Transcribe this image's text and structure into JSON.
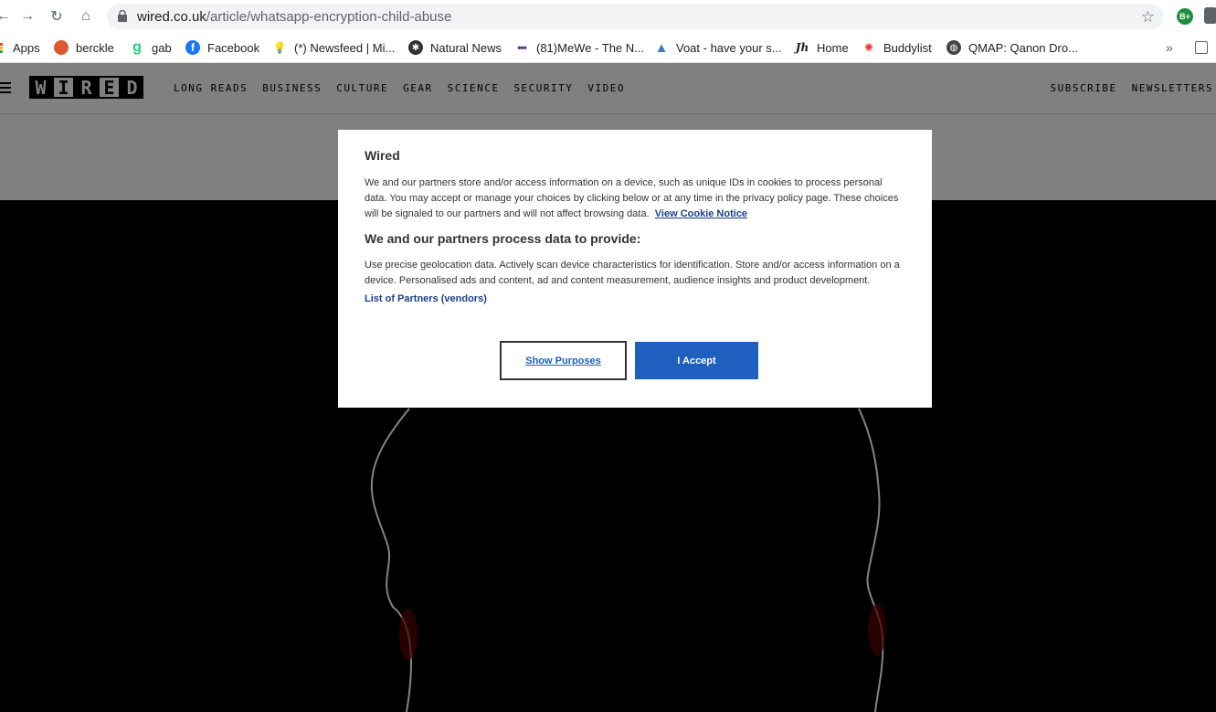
{
  "browser": {
    "url_domain": "wired.co.uk",
    "url_path": "/article/whatsapp-encryption-child-abuse",
    "ext_avatar": "B+",
    "bookmarks": [
      {
        "label": "Apps",
        "icon": "apps-grid-icon"
      },
      {
        "label": "berckle",
        "icon": "berckle-icon"
      },
      {
        "label": "gab",
        "icon": "gab-icon"
      },
      {
        "label": "Facebook",
        "icon": "facebook-icon"
      },
      {
        "label": "(*) Newsfeed | Mi...",
        "icon": "lightbulb-icon"
      },
      {
        "label": "Natural News",
        "icon": "natural-news-icon"
      },
      {
        "label": "(81)MeWe - The N...",
        "icon": "mewe-icon"
      },
      {
        "label": "Voat - have your s...",
        "icon": "voat-icon"
      },
      {
        "label": "Home",
        "icon": "jh-icon"
      },
      {
        "label": "Buddylist",
        "icon": "buddylist-icon"
      },
      {
        "label": "QMAP: Qanon Dro...",
        "icon": "globe-icon"
      }
    ],
    "bookmarks_overflow": "»"
  },
  "site": {
    "logo": [
      "W",
      "I",
      "R",
      "E",
      "D"
    ],
    "nav": [
      "LONG READS",
      "BUSINESS",
      "CULTURE",
      "GEAR",
      "SCIENCE",
      "SECURITY",
      "VIDEO"
    ],
    "right_nav": [
      "SUBSCRIBE",
      "NEWSLETTERS"
    ]
  },
  "consent": {
    "title": "Wired",
    "intro": "We and our partners store and/or access information on a device, such as unique IDs in cookies to process personal data. You may accept or manage your choices by clicking below or at any time in the privacy policy page. These choices will be signaled to our partners and will not affect browsing data.",
    "cookie_link": "View Cookie Notice",
    "purposes_heading": "We and our partners process data to provide:",
    "purposes_text": "Use precise geolocation data. Actively scan device characteristics for identification. Store and/or access information on a device. Personalised ads and content, ad and content measurement, audience insights and product development.",
    "partners_link": "List of Partners (vendors)",
    "show_purposes": "Show Purposes",
    "accept": "I Accept"
  },
  "colors": {
    "accent": "#1e5fbf",
    "link": "#1a3e8e",
    "header_bg": "#808080"
  }
}
